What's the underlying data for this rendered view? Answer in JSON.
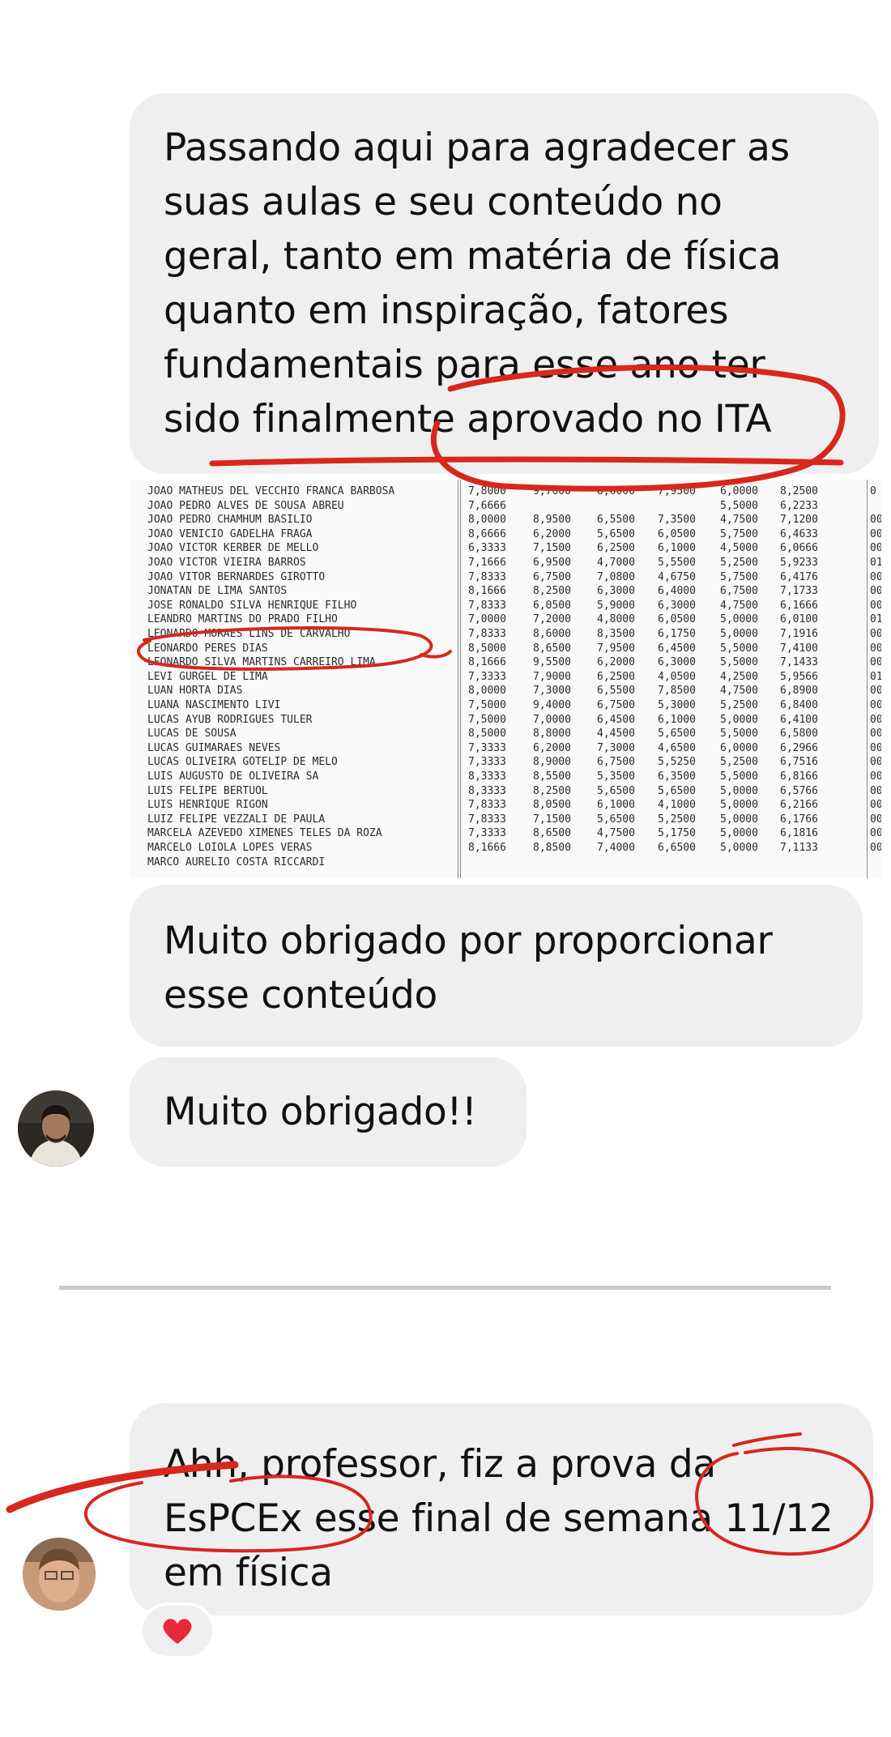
{
  "messages": {
    "m1_lines": [
      "Passando aqui para agradecer as",
      "suas aulas e seu conteúdo no",
      "geral, tanto em matéria de física",
      "quanto em inspiração, fatores",
      "fundamentais para esse ano ter",
      "sido finalmente aprovado no ITA"
    ],
    "m2_lines": [
      "Muito obrigado por proporcionar",
      "esse conteúdo"
    ],
    "m3": "Muito obrigado!!",
    "m4_lines": [
      "Ahh, professor, fiz a prova da",
      "EsPCEx esse final de semana 11/12",
      "em física"
    ]
  },
  "reaction": "❤️",
  "result_sheet": {
    "rows": [
      {
        "name": "JOAO MATHEUS DEL VECCHIO FRANCA BARBOSA",
        "scores": [
          "7,8000",
          "9,7000",
          "8,6000",
          "7,9500",
          "6,0000",
          "8,2500"
        ]
      },
      {
        "name": "JOAO PEDRO ALVES DE SOUSA ABREU",
        "scores": [
          "7,6666",
          "",
          "",
          "",
          "5,5000",
          "6,2233"
        ]
      },
      {
        "name": "JOAO PEDRO CHAMHUM BASILIO",
        "scores": [
          "8,0000",
          "8,9500",
          "6,5500",
          "7,3500",
          "4,7500",
          "7,1200"
        ]
      },
      {
        "name": "JOAO VENICIO GADELHA FRAGA",
        "scores": [
          "8,6666",
          "6,2000",
          "5,6500",
          "6,0500",
          "5,7500",
          "6,4633"
        ]
      },
      {
        "name": "JOAO VICTOR KERBER DE MELLO",
        "scores": [
          "6,3333",
          "7,1500",
          "6,2500",
          "6,1000",
          "4,5000",
          "6,0666"
        ]
      },
      {
        "name": "JOAO VICTOR VIEIRA BARROS",
        "scores": [
          "7,1666",
          "6,9500",
          "4,7000",
          "5,5500",
          "5,2500",
          "5,9233"
        ]
      },
      {
        "name": "JOAO VITOR BERNARDES GIROTTO",
        "scores": [
          "7,8333",
          "6,7500",
          "7,0800",
          "4,6750",
          "5,7500",
          "6,4176"
        ]
      },
      {
        "name": "JONATAN DE LIMA SANTOS",
        "scores": [
          "8,1666",
          "8,2500",
          "6,3000",
          "6,4000",
          "6,7500",
          "7,1733"
        ]
      },
      {
        "name": "JOSE RONALDO SILVA HENRIQUE FILHO",
        "scores": [
          "7,8333",
          "6,0500",
          "5,9000",
          "6,3000",
          "4,7500",
          "6,1666"
        ]
      },
      {
        "name": "LEANDRO MARTINS DO PRADO FILHO",
        "scores": [
          "7,0000",
          "7,2000",
          "4,8000",
          "6,0500",
          "5,0000",
          "6,0100"
        ]
      },
      {
        "name": "LEONARDO MORAES LINS DE CARVALHO",
        "scores": [
          "7,8333",
          "8,6000",
          "8,3500",
          "6,1750",
          "5,0000",
          "7,1916"
        ]
      },
      {
        "name": "LEONARDO PERES DIAS",
        "scores": [
          "8,5000",
          "8,6500",
          "7,9500",
          "6,4500",
          "5,5000",
          "7,4100"
        ]
      },
      {
        "name": "LEONARDO SILVA MARTINS CARREIRO LIMA",
        "scores": [
          "8,1666",
          "9,5500",
          "6,2000",
          "6,3000",
          "5,5000",
          "7,1433"
        ]
      },
      {
        "name": "LEVI GURGEL DE LIMA",
        "scores": [
          "7,3333",
          "7,9000",
          "6,2500",
          "4,0500",
          "4,2500",
          "5,9566"
        ]
      },
      {
        "name": "LUAN HORTA DIAS",
        "scores": [
          "8,0000",
          "7,3000",
          "6,5500",
          "7,8500",
          "4,7500",
          "6,8900"
        ]
      },
      {
        "name": "LUANA NASCIMENTO LIVI",
        "scores": [
          "7,5000",
          "9,4000",
          "6,7500",
          "5,3000",
          "5,2500",
          "6,8400"
        ]
      },
      {
        "name": "LUCAS AYUB RODRIGUES TULER",
        "scores": [
          "7,5000",
          "7,0000",
          "6,4500",
          "6,1000",
          "5,0000",
          "6,4100"
        ]
      },
      {
        "name": "LUCAS DE SOUSA",
        "scores": [
          "8,5000",
          "8,8000",
          "4,4500",
          "5,6500",
          "5,5000",
          "6,5800"
        ]
      },
      {
        "name": "LUCAS GUIMARAES NEVES",
        "scores": [
          "7,3333",
          "6,2000",
          "7,3000",
          "4,6500",
          "6,0000",
          "6,2966"
        ]
      },
      {
        "name": "LUCAS OLIVEIRA GOTELIP DE MELO",
        "scores": [
          "7,3333",
          "8,9000",
          "6,7500",
          "5,5250",
          "5,2500",
          "6,7516"
        ]
      },
      {
        "name": "LUIS AUGUSTO DE OLIVEIRA SA",
        "scores": [
          "8,3333",
          "8,5500",
          "5,3500",
          "6,3500",
          "5,5000",
          "6,8166"
        ]
      },
      {
        "name": "LUIS FELIPE BERTUOL",
        "scores": [
          "8,3333",
          "8,2500",
          "5,6500",
          "5,6500",
          "5,0000",
          "6,5766"
        ]
      },
      {
        "name": "LUIS HENRIQUE RIGON",
        "scores": [
          "7,8333",
          "8,0500",
          "6,1000",
          "4,1000",
          "5,0000",
          "6,2166"
        ]
      },
      {
        "name": "LUIZ FELIPE VEZZALI DE PAULA",
        "scores": [
          "7,8333",
          "7,1500",
          "5,6500",
          "5,2500",
          "5,0000",
          "6,1766"
        ]
      },
      {
        "name": "MARCELA AZEVEDO XIMENES TELES DA ROZA",
        "scores": [
          "7,3333",
          "8,6500",
          "4,7500",
          "5,1750",
          "5,0000",
          "6,1816"
        ]
      },
      {
        "name": "MARCELO LOIOLA LOPES VERAS",
        "scores": [
          "8,1666",
          "8,8500",
          "7,4000",
          "6,6500",
          "5,0000",
          "7,1133"
        ]
      },
      {
        "name": "MARCO AURELIO COSTA RICCARDI",
        "scores": [
          "",
          "",
          "",
          "",
          "",
          ""
        ]
      }
    ],
    "tail_codes": [
      "0",
      "",
      "00",
      "00",
      "00",
      "01",
      "00",
      "00",
      "00",
      "01",
      "00",
      "00",
      "00",
      "01",
      "00",
      "00",
      "00",
      "00",
      "00",
      "00",
      "00",
      "00",
      "00",
      "00",
      "00",
      "00",
      ""
    ]
  },
  "colors": {
    "bubble": "#efefef",
    "annotation": "#d8271c",
    "divider": "#c9c9c9",
    "text": "#111111"
  }
}
